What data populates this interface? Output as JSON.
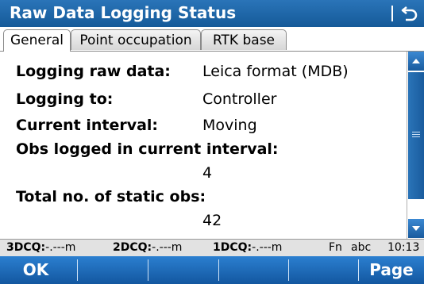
{
  "window": {
    "title": "Raw Data Logging Status"
  },
  "tabs": [
    {
      "label": "General",
      "active": true
    },
    {
      "label": "Point occupation",
      "active": false
    },
    {
      "label": "RTK base",
      "active": false
    }
  ],
  "fields": {
    "logging_raw_data": {
      "label": "Logging raw data:",
      "value": "Leica format (MDB)"
    },
    "logging_to": {
      "label": "Logging to:",
      "value": "Controller"
    },
    "current_interval": {
      "label": "Current interval:",
      "value": "Moving"
    },
    "obs_logged": {
      "label": "Obs logged in current interval:",
      "value": "4"
    },
    "total_static_obs": {
      "label": "Total no. of static obs:",
      "value": "42"
    }
  },
  "status": {
    "dcq3_label": "3DCQ:",
    "dcq3_value": "-.---m",
    "dcq2_label": "2DCQ:",
    "dcq2_value": "-.---m",
    "dcq1_label": "1DCQ:",
    "dcq1_value": "-.---m",
    "fn": "Fn",
    "input_mode": "abc",
    "time": "10:13"
  },
  "softkeys": {
    "ok": "OK",
    "page": "Page"
  },
  "colors": {
    "titlebar": "#155a99",
    "softkey_bar": "#1a63b0",
    "status_bar": "#e2e2e2"
  }
}
